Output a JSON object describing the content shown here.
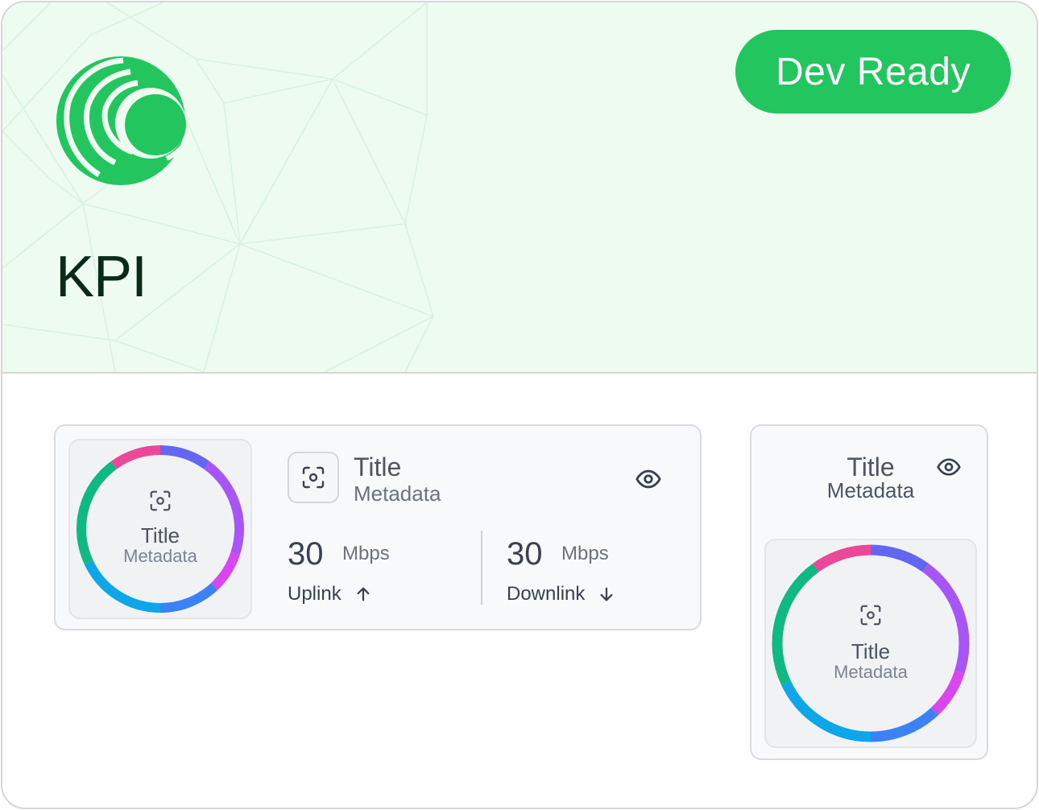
{
  "page": {
    "title": "KPI",
    "status": "Dev Ready",
    "colors": {
      "accent": "#22c55e",
      "hero_bg": "#eefbf1",
      "title": "#0a2a15"
    }
  },
  "logo": {
    "icon": "brand-logo-icon"
  },
  "kpi_card": {
    "icon": "focus-icon",
    "title": "Title",
    "metadata": "Metadata",
    "view_icon": "eye-icon",
    "ring": {
      "title": "Title",
      "metadata": "Metadata",
      "icon": "focus-icon"
    },
    "uplink": {
      "value": "30",
      "unit": "Mbps",
      "label": "Uplink",
      "icon": "arrow-up-icon"
    },
    "downlink": {
      "value": "30",
      "unit": "Mbps",
      "label": "Downlink",
      "icon": "arrow-down-icon"
    }
  },
  "kpi_tile": {
    "title": "Title",
    "metadata": "Metadata",
    "view_icon": "eye-icon",
    "ring": {
      "title": "Title",
      "metadata": "Metadata",
      "icon": "focus-icon"
    }
  },
  "ring_segments": [
    {
      "color": "#6366f1",
      "fraction": 0.1
    },
    {
      "color": "#a855f7",
      "fraction": 0.2
    },
    {
      "color": "#d946ef",
      "fraction": 0.08
    },
    {
      "color": "#3b82f6",
      "fraction": 0.12
    },
    {
      "color": "#0ea5e9",
      "fraction": 0.18
    },
    {
      "color": "#10b981",
      "fraction": 0.22
    },
    {
      "color": "#ec4899",
      "fraction": 0.1
    }
  ]
}
